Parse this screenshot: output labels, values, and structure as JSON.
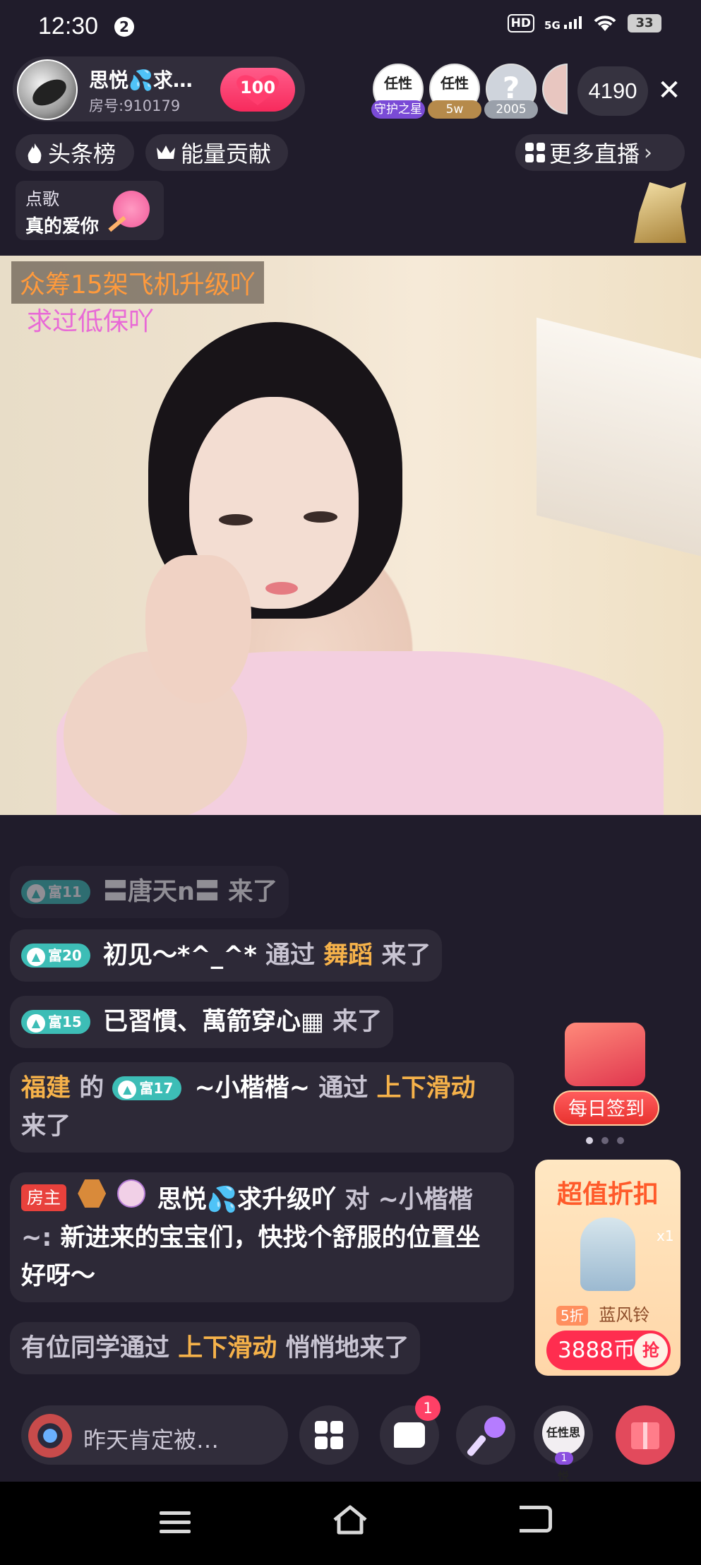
{
  "status_bar": {
    "time": "12:30",
    "notification_count": "2",
    "hd": "HD",
    "network": "5G",
    "battery": "33"
  },
  "room": {
    "anchor_name": "思悦💦求…",
    "room_id": "房号:910179",
    "follow_count": "100",
    "viewers": "4190",
    "top_fans": [
      {
        "glyph": "任性",
        "tag": "守护之星",
        "icon": "fan-avatar-icon"
      },
      {
        "glyph": "任性",
        "tag": "5w",
        "icon": "fan-avatar-icon"
      },
      {
        "glyph": "?",
        "tag": "2005",
        "icon": "mystery-avatar-icon"
      }
    ]
  },
  "tabs": {
    "headline": "头条榜",
    "energy": "能量贡献",
    "more_live": "更多直播"
  },
  "song": {
    "label": "点歌",
    "name": "真的爱你"
  },
  "video": {
    "banner1": "众筹15架飞机升级吖",
    "banner2": "求过低保吖"
  },
  "chat": [
    {
      "level": "富11",
      "user": "〓唐天n〓",
      "action": "来了"
    },
    {
      "level": "富20",
      "user": "初见～*^_^*",
      "via": "通过",
      "source": "舞蹈",
      "action": "来了"
    },
    {
      "level": "富15",
      "user": "已習慣、萬箭穿心▦",
      "action": "来了"
    },
    {
      "location": "福建",
      "of": "的",
      "level": "富17",
      "user": "~小楷楷~",
      "via": "通过",
      "source": "上下滑动",
      "action": "来了"
    },
    {
      "host_tag": "房主",
      "user": "思悦💦求升级吖",
      "to": "对 ~小楷楷~:",
      "message": "新进来的宝宝们，快找个舒服的位置坐好呀～"
    },
    {
      "prefix": "有位同学通过",
      "source": "上下滑动",
      "action": "悄悄地来了"
    }
  ],
  "promo": {
    "checkin": "每日签到",
    "deal_title": "超值折扣",
    "deal_discount": "5折",
    "deal_item": "蓝风铃",
    "deal_price": "3888币",
    "deal_grab": "抢",
    "deal_extra": "x1"
  },
  "bottom": {
    "input_placeholder": "昨天肯定被…",
    "chat_badge": "1",
    "avatar_glyph": "任性思悦",
    "avatar_level": "1"
  }
}
